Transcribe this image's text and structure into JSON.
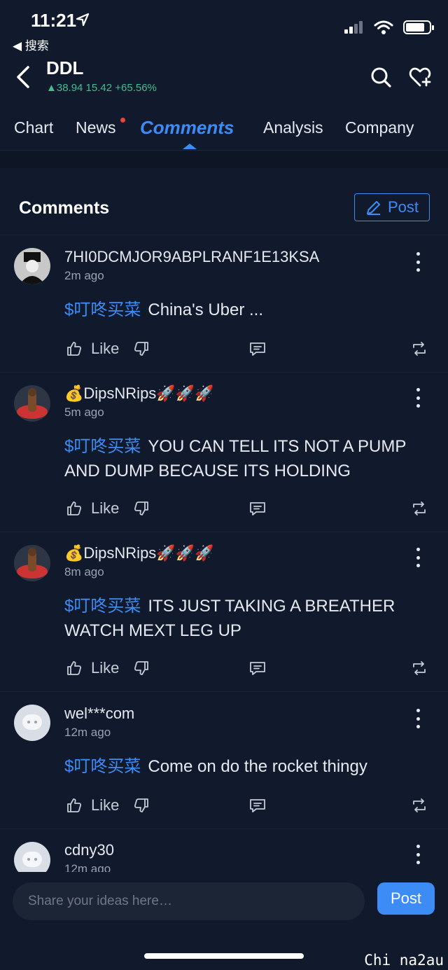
{
  "status_bar": {
    "time": "11:21",
    "back_app": "◀ 搜索"
  },
  "header": {
    "ticker": "DDL",
    "quote": "▲38.94 15.42 +65.56%"
  },
  "tabs": [
    {
      "label": "Chart"
    },
    {
      "label": "News",
      "has_dot": true
    },
    {
      "label": "Comments",
      "active": true
    },
    {
      "label": "Analysis"
    },
    {
      "label": "Company"
    }
  ],
  "comments_section": {
    "title": "Comments",
    "post_label": "Post"
  },
  "comments": [
    {
      "user": "7HI0DCMJOR9ABPLRANF1E13KSA",
      "time": "2m ago",
      "tag": "$叮咚买菜",
      "text": "China's Uber ...",
      "like_label": "Like"
    },
    {
      "user": "💰DipsNRips🚀🚀🚀",
      "time": "5m ago",
      "tag": "$叮咚买菜",
      "text": "YOU CAN TELL ITS NOT A PUMP AND DUMP BECAUSE ITS HOLDING",
      "like_label": "Like"
    },
    {
      "user": "💰DipsNRips🚀🚀🚀",
      "time": "8m ago",
      "tag": "$叮咚买菜",
      "text": "ITS JUST TAKING A BREATHER WATCH MEXT LEG UP",
      "like_label": "Like"
    },
    {
      "user": "wel***com",
      "time": "12m ago",
      "tag": "$叮咚买菜",
      "text": "Come on do the rocket thingy",
      "like_label": "Like"
    },
    {
      "user": "cdny30",
      "time": "12m ago"
    }
  ],
  "composer": {
    "placeholder": "Share your ideas here…",
    "post_label": "Post"
  },
  "watermark": "Chi na2au",
  "colors": {
    "background": "#111a2c",
    "accent": "#3d8bf5",
    "gain": "#3fbf8f",
    "notification_dot": "#e5453d"
  }
}
